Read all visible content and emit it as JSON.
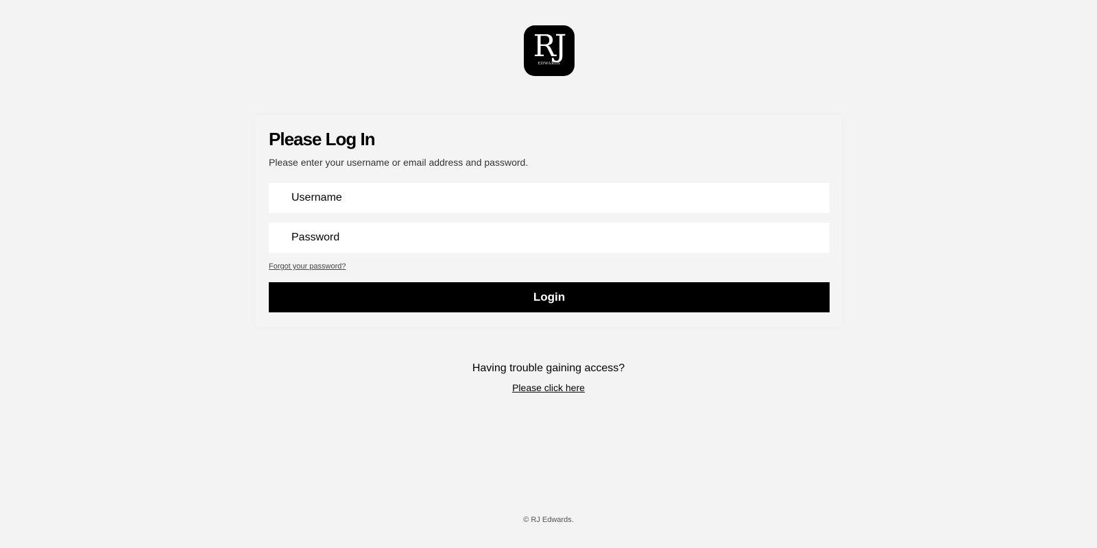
{
  "logo": {
    "mark": "RJ",
    "sub": "EDWARDS"
  },
  "login": {
    "title": "Please Log In",
    "subtitle": "Please enter your username or email address and password.",
    "username_placeholder": "Username",
    "password_placeholder": "Password",
    "forgot_label": "Forgot your password?",
    "button_label": "Login"
  },
  "help": {
    "trouble_text": "Having trouble gaining access?",
    "link_label": "Please click here"
  },
  "footer": {
    "copyright": "© RJ Edwards."
  }
}
